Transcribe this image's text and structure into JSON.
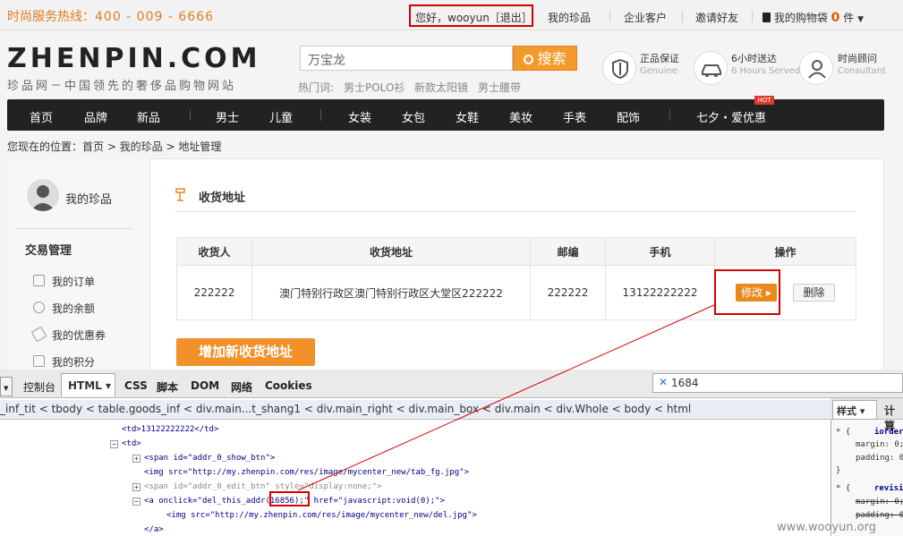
{
  "topbar": {
    "hotline_label": "时尚服务热线：",
    "hotline_number": "400 - 009 - 6666",
    "greeting": "您好，wooyun［退出］",
    "links": [
      "我的珍品",
      "企业客户",
      "邀请好友"
    ],
    "cart_label": "我的购物袋",
    "cart_count": "0",
    "cart_unit": "件"
  },
  "header": {
    "logo": "ZHENPIN.COM",
    "slogan": "珍品网－中国领先的奢侈品购物网站",
    "search_value": "万宝龙",
    "search_button": "搜索",
    "hot_label": "热门词:",
    "hot_keywords": [
      "男士POLO衫",
      "新款太阳镜",
      "男士腰带"
    ],
    "services": [
      {
        "title": "正品保证",
        "subtitle": "Genuine"
      },
      {
        "title": "6小时送达",
        "subtitle": "6 Hours Served"
      },
      {
        "title": "时尚顾问",
        "subtitle": "Consultant"
      }
    ]
  },
  "nav": {
    "items": [
      "首页",
      "品牌",
      "新品",
      "男士",
      "儿童",
      "女装",
      "女包",
      "女鞋",
      "美妆",
      "手表",
      "配饰",
      "七夕・爱优惠"
    ],
    "hot_tag": "HOT"
  },
  "breadcrumb": "您现在的位置：首页 > 我的珍品 > 地址管理",
  "sidebar": {
    "title": "我的珍品",
    "section": "交易管理",
    "items": [
      "我的订单",
      "我的余额",
      "我的优惠券",
      "我的积分"
    ]
  },
  "address": {
    "title": "收货地址",
    "columns": [
      "收货人",
      "收货地址",
      "邮编",
      "手机",
      "操作"
    ],
    "rows": [
      {
        "name": "222222",
        "address": "澳门特别行政区澳门特别行政区大堂区222222",
        "zip": "222222",
        "phone": "13122222222",
        "edit": "修改 ▸",
        "delete": "删除"
      }
    ],
    "add_button": "增加新收货地址"
  },
  "devtools": {
    "tabs": [
      "控制台",
      "HTML ▾",
      "CSS",
      "脚本",
      "DOM",
      "网络",
      "Cookies"
    ],
    "search": "1684",
    "breadcrumbs": "_inf_tit < tbody < table.goods_inf < div.main...t_shang1 < div.main_right < div.main_box < div.main < div.Whole < body < html",
    "side_tabs": [
      "样式 ▾",
      "计算"
    ],
    "code_lines": [
      "<td>13122222222</td>",
      "<td>",
      "<span id=\"addr_0_show_btn\">",
      "<img src=\"http://my.zhenpin.com/res/image/mycenter_new/tab_fg.jpg\">",
      "<span id=\"addr_0_edit_btn\" style=\"display:none;\">",
      "<a onclick=\"del_this_addr(16856);\" href=\"javascript:void(0);\">",
      "<img src=\"http://my.zhenpin.com/res/image/mycenter_new/del.jpg\">",
      "</a>"
    ],
    "css_lines": [
      "* {",
      "iorder",
      "margin: 0;",
      "padding: 0",
      "}",
      "* {",
      "revisi",
      "margin: 0;",
      "padding: 0"
    ]
  },
  "watermark": "www.wooyun.org"
}
